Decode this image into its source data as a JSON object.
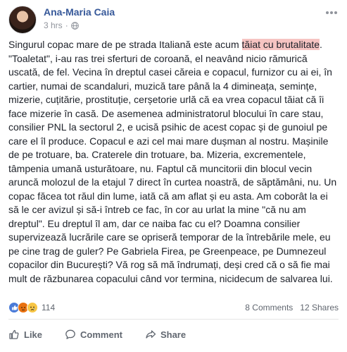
{
  "post": {
    "author": "Ana-Maria Caia",
    "time": "3 hrs",
    "separator": "·",
    "text_before_highlight": "Singurul copac mare de pe strada Italiană este acum ",
    "text_highlight": "tăiat cu brutalitate",
    "text_after_highlight": ". \"Toaletat\", i-au ras trei sferturi de coroană, el neavând nicio rămurică uscată, de fel. Vecina în dreptul casei căreia e copacul, furnizor cu ai ei, în cartier, numai de scandaluri, muzică tare până la 4 dimineața, semințe, mizerie, cuțitărie, prostituție, cerșetorie urlă că ea vrea copacul tăiat că îi face mizerie în casă. De asemenea administratorul blocului în care stau, consilier PNL la sectorul 2, e ucisă psihic de acest copac și de gunoiul pe care el îl produce. Copacul e azi cel mai mare dușman al nostru. Mașinile de pe trotuare, ba. Craterele din trotuare, ba. Mizeria, excrementele, tâmpenia umană usturătoare, nu. Faptul că muncitorii din blocul vecin aruncă molozul de la etajul 7 direct în curtea noastră, de săptămâni, nu. Un copac făcea tot răul din lume, iată că am aflat și eu asta. Am coborât la ei să le cer avizul și să-i întreb ce fac, în cor au urlat la mine \"că nu am dreptul\". Eu dreptul îl am, dar ce naiba fac cu el? Doamna consilier supervizează lucrările care se opriseră temporar de la întrebările mele, eu pe cine trag de guler? Pe Gabriela Firea, pe Greenpeace, pe Dumnezeul copacilor din București? Vă rog să mă îndrumați, deși cred că o să fie mai mult de răzbunarea copacului când vor termina, nicidecum de salvarea lui."
  },
  "reactions": {
    "count": "114",
    "icons": [
      "like-icon",
      "angry-icon",
      "sad-icon"
    ],
    "comments": "8 Comments",
    "shares": "12 Shares"
  },
  "actions": {
    "like": "Like",
    "comment": "Comment",
    "share": "Share"
  },
  "colors": {
    "author_link": "#365899",
    "highlight": "#f6c4c2",
    "muted_text": "#90949c",
    "action_text": "#616770"
  }
}
